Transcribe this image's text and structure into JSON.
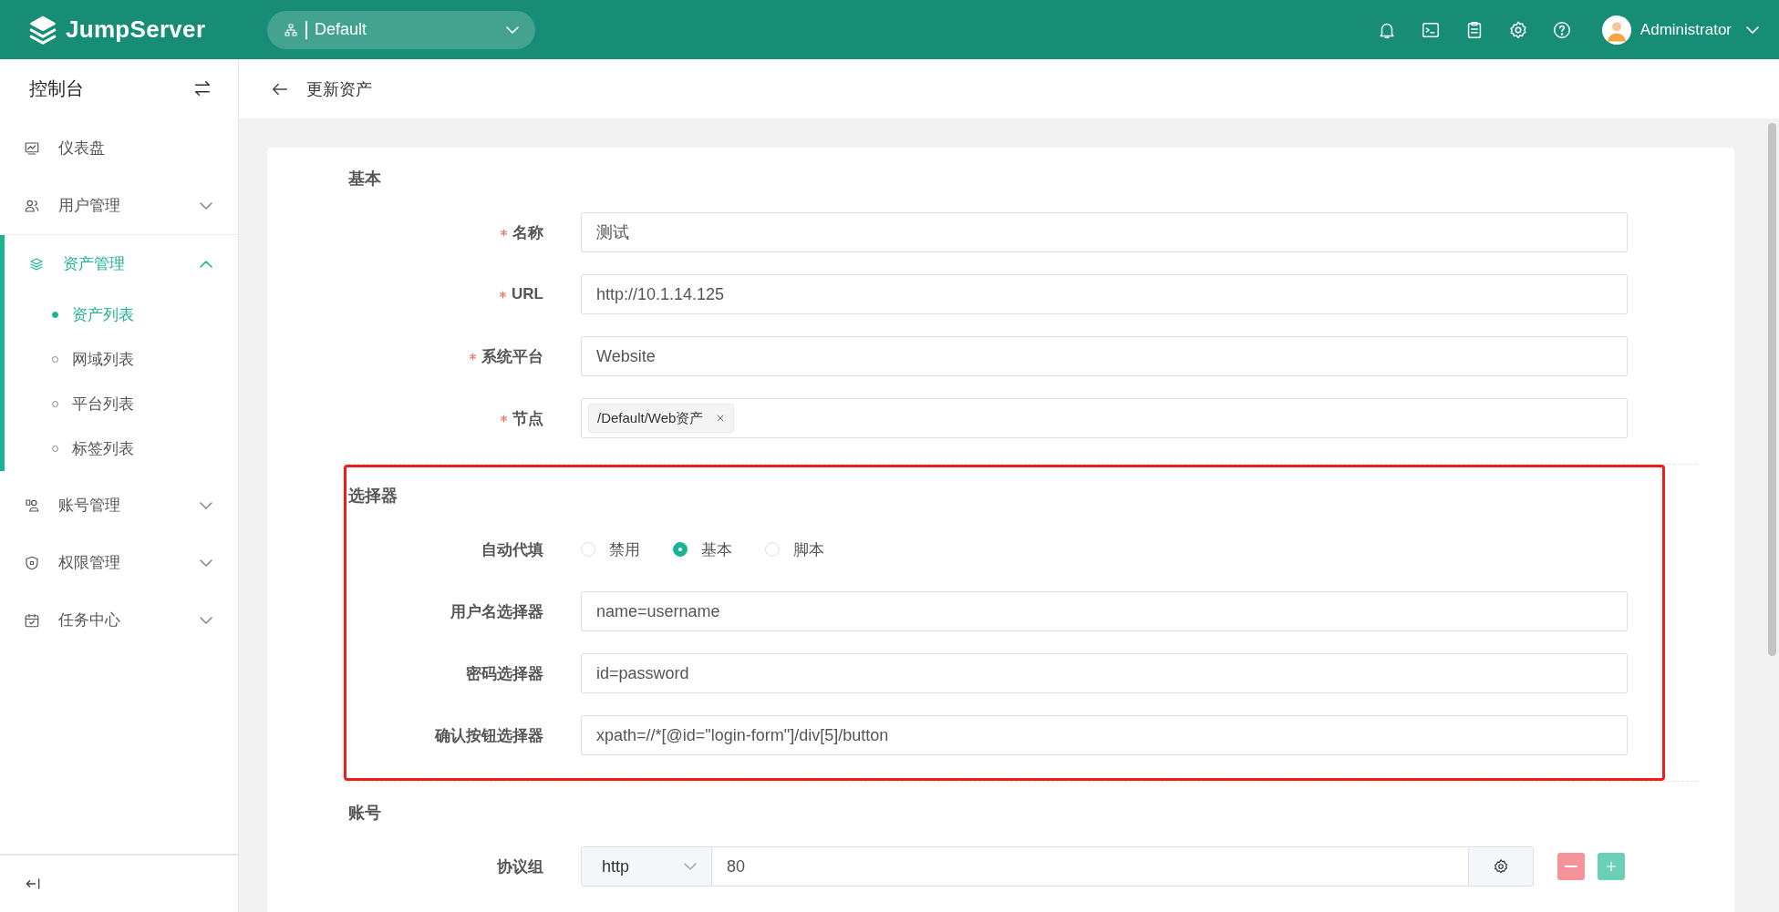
{
  "topbar": {
    "logo": "JumpServer",
    "org": "Default",
    "user": "Administrator"
  },
  "sidebar": {
    "title": "控制台",
    "items": [
      {
        "label": "仪表盘",
        "kind": "link",
        "selected": false
      },
      {
        "label": "用户管理",
        "kind": "group",
        "selected": false,
        "expanded": false
      },
      {
        "label": "资产管理",
        "kind": "group",
        "selected": true,
        "expanded": true,
        "children": [
          {
            "label": "资产列表",
            "selected": true
          },
          {
            "label": "网域列表",
            "selected": false
          },
          {
            "label": "平台列表",
            "selected": false
          },
          {
            "label": "标签列表",
            "selected": false
          }
        ]
      },
      {
        "label": "账号管理",
        "kind": "group",
        "selected": false,
        "expanded": false
      },
      {
        "label": "权限管理",
        "kind": "group",
        "selected": false,
        "expanded": false
      },
      {
        "label": "任务中心",
        "kind": "group",
        "selected": false,
        "expanded": false
      }
    ]
  },
  "page_title": "更新资产",
  "sections": [
    {
      "title": "基本",
      "highlighted": false,
      "fields": [
        {
          "label": "名称",
          "required": true,
          "kind": "text",
          "value": "测试"
        },
        {
          "label": "URL",
          "required": true,
          "kind": "text",
          "value": "http://10.1.14.125"
        },
        {
          "label": "系统平台",
          "required": true,
          "kind": "text",
          "value": "Website"
        },
        {
          "label": "节点",
          "required": true,
          "kind": "tags",
          "tags": [
            "/Default/Web资产"
          ]
        }
      ]
    },
    {
      "title": "选择器",
      "highlighted": true,
      "fields": [
        {
          "label": "自动代填",
          "required": false,
          "kind": "radio",
          "options": [
            {
              "label": "禁用",
              "selected": false
            },
            {
              "label": "基本",
              "selected": true
            },
            {
              "label": "脚本",
              "selected": false
            }
          ]
        },
        {
          "label": "用户名选择器",
          "required": false,
          "kind": "text",
          "value": "name=username"
        },
        {
          "label": "密码选择器",
          "required": false,
          "kind": "text",
          "value": "id=password"
        },
        {
          "label": "确认按钮选择器",
          "required": false,
          "kind": "text",
          "value": "xpath=//*[@id=\"login-form\"]/div[5]/button"
        }
      ]
    },
    {
      "title": "账号",
      "highlighted": false,
      "fields": [
        {
          "label": "协议组",
          "required": false,
          "kind": "protocol",
          "protocol": "http",
          "port": "80"
        }
      ]
    }
  ]
}
